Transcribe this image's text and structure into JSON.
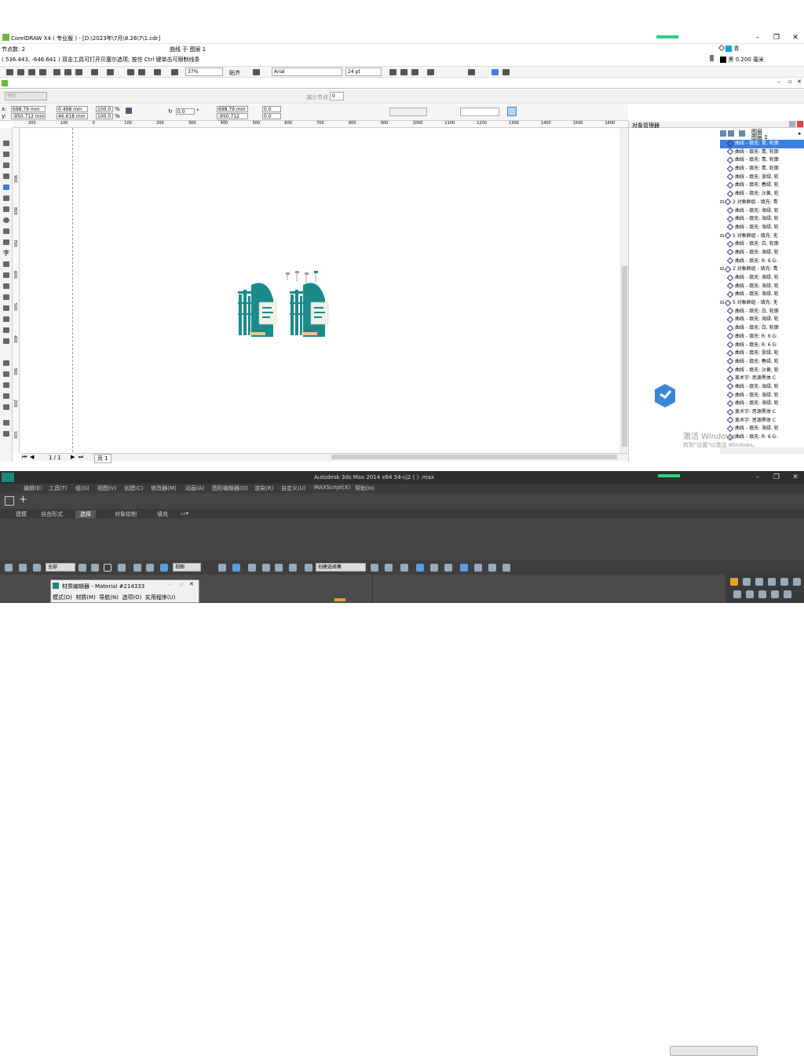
{
  "cdr": {
    "title": "CorelDRAW X4 ( 专业版 ) - [D:\\2023年\\7月\\8.26\\7\\1.cdr]",
    "status_nodes": "节点数: 2",
    "status_coords": "( 536.443, -646.641 )  双击工具可打开贝塞尔选项; 按住 Ctrl 键单击可限制线条",
    "status_layer": "曲线 于 图层 1",
    "fill_label": "青",
    "outline_label": "黑  0.200 毫米",
    "zoom": "37%",
    "snap": "贴齐",
    "font": "Arial",
    "font_size": "24 pt",
    "style_box": "预打",
    "nodes_label": "减少节点",
    "nodes_value": "0",
    "x_pos": "698.79 mm",
    "y_pos": "-950.712 mm",
    "w_size": "0.498 mm",
    "h_size": "46.618 mm",
    "scale_x": "100.0",
    "scale_y": "100.0",
    "percent": "%",
    "rotation": "0.0",
    "deg": "°",
    "cx": "698.79 mm",
    "cy": "-950.712 mm",
    "ox": "0.0",
    "oy": "0.0",
    "page_nav": "1 / 1",
    "page_tab": "页 1",
    "ruler_top": [
      "200",
      "100",
      "0",
      "100",
      "200",
      "300",
      "400",
      "500",
      "600",
      "700",
      "800",
      "900",
      "1000",
      "1100",
      "1200",
      "1300",
      "1400",
      "1500",
      "1600"
    ],
    "ruler_left": [
      "900",
      "800",
      "700",
      "600",
      "500",
      "400",
      "300",
      "200",
      "100"
    ],
    "obj_mgr_title": "对象管理器",
    "om_page": "图层",
    "om_layer": "图层 1",
    "om_rows": [
      {
        "t": "曲线 - 填充: 青, 轮廓",
        "sel": true
      },
      {
        "t": "曲线 - 填充: 青, 轮廓"
      },
      {
        "t": "曲线 - 填充: 青, 轮廓"
      },
      {
        "t": "曲线 - 填充: 青, 轮廓"
      },
      {
        "t": "曲线 - 填充: 浙绿, 轮"
      },
      {
        "t": "曲线 - 填充: 春绿, 轮"
      },
      {
        "t": "曲线 - 填充: 沙黄, 轮"
      },
      {
        "t": "2 对象群组 - 填充: 青",
        "group": true
      },
      {
        "t": "曲线 - 填充: 海绿, 轮"
      },
      {
        "t": "曲线 - 填充: 海绿, 轮"
      },
      {
        "t": "曲线 - 填充: 海绿, 轮"
      },
      {
        "t": "5 对象群组 - 填充: 无",
        "group": true
      },
      {
        "t": "曲线 - 填充: 白, 轮廓"
      },
      {
        "t": "曲线 - 填充: 海绿, 轮"
      },
      {
        "t": "曲线 - 填充: R: 6 G:"
      },
      {
        "t": "2 对象群组 - 填充: 青",
        "group": true
      },
      {
        "t": "曲线 - 填充: 海绿, 轮"
      },
      {
        "t": "曲线 - 填充: 海绿, 轮"
      },
      {
        "t": "曲线 - 填充: 海绿, 轮"
      },
      {
        "t": "5 对象群组 - 填充: 无",
        "group": true
      },
      {
        "t": "曲线 - 填充: 白, 轮廓"
      },
      {
        "t": "曲线 - 填充: 海绿, 轮"
      },
      {
        "t": "曲线 - 填充: 白, 轮廓"
      },
      {
        "t": "曲线 - 填充: R: 6 G:"
      },
      {
        "t": "曲线 - 填充: R: 6 G:"
      },
      {
        "t": "曲线 - 填充: 浙绿, 轮"
      },
      {
        "t": "曲线 - 填充: 春绿, 轮"
      },
      {
        "t": "曲线 - 填充: 沙黄, 轮"
      },
      {
        "t": "美术字: 思源黑体 C"
      },
      {
        "t": "曲线 - 填充: 海绿, 轮"
      },
      {
        "t": "曲线 - 填充: 海绿, 轮"
      },
      {
        "t": "曲线 - 填充: 海绿, 轮"
      },
      {
        "t": "美术字: 思源黑体 C"
      },
      {
        "t": "美术字: 思源黑体 C"
      },
      {
        "t": "曲线 - 填充: 海绿, 轮"
      },
      {
        "t": "曲线 - 填充: R: 6 G:"
      }
    ]
  },
  "win_activation": {
    "line1": "激活 Windows",
    "line2": "转到\"设置\"以激活 Windows。"
  },
  "max": {
    "title": "Autodesk 3ds Max  2014 x64     54-cj2  ( )  .max",
    "menus": [
      "编辑(E)",
      "工具(T)",
      "组(G)",
      "视图(V)",
      "创建(C)",
      "修改器(M)",
      "动画(A)",
      "图形编辑器(D)",
      "渲染(R)",
      "自定义(U)",
      "MAXScript(X)",
      "帮助(H)"
    ],
    "ribbon": [
      "建模",
      "自由形式",
      "选择",
      "对象绘制",
      "填充"
    ],
    "filter": "全部",
    "view": "视图",
    "selset": "创建选择集",
    "mat_title": "材质编辑器 - Material #214333",
    "mat_menu": [
      "模式(D)",
      "材质(M)",
      "导航(N)",
      "选项(O)",
      "实用程序(U)"
    ]
  },
  "colors": {
    "accent": "#00a6d6",
    "teal": "#1a8a8a",
    "selection": "#3a7fe0"
  }
}
